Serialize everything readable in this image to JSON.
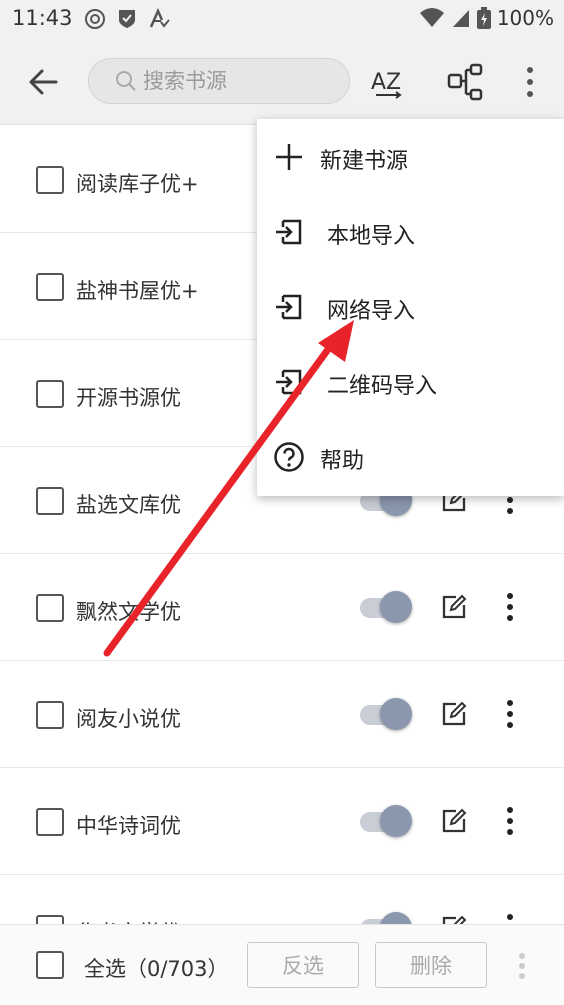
{
  "status_bar": {
    "time": "11:43",
    "battery": "100%",
    "icons": [
      "at-sign-icon",
      "shield-check-icon",
      "translate-icon",
      "wifi-icon",
      "signal-icon",
      "battery-charging-icon"
    ]
  },
  "toolbar": {
    "back_icon": "arrow-left-icon",
    "search_placeholder": "搜索书源",
    "search_icon": "search-icon",
    "sort_icon": "sort-az-icon",
    "group_icon": "group-tree-icon",
    "more_icon": "more-vertical-icon"
  },
  "sources": [
    {
      "name": "阅读库子优+",
      "enabled": true
    },
    {
      "name": "盐神书屋优+",
      "enabled": true
    },
    {
      "name": "开源书源优",
      "enabled": true
    },
    {
      "name": "盐选文库优",
      "enabled": true
    },
    {
      "name": "飘然文学优",
      "enabled": true
    },
    {
      "name": "阅友小说优",
      "enabled": true
    },
    {
      "name": "中华诗词优",
      "enabled": true
    },
    {
      "name": "华书文学优",
      "enabled": true
    }
  ],
  "menu": {
    "items": [
      {
        "label": "新建书源",
        "icon": "plus-icon"
      },
      {
        "label": "本地导入",
        "icon": "import-icon"
      },
      {
        "label": "网络导入",
        "icon": "import-icon"
      },
      {
        "label": "二维码导入",
        "icon": "import-icon"
      },
      {
        "label": "帮助",
        "icon": "help-circle-icon"
      }
    ]
  },
  "bottom_bar": {
    "select_all": "全选（0/703）",
    "invert_label": "反选",
    "delete_label": "删除",
    "more_icon": "more-vertical-icon"
  },
  "colors": {
    "toolbar_bg": "#f1f1f1",
    "toggle_knob": "#8a97ad",
    "toggle_track": "#c9cdd5",
    "annotation_arrow": "#e8232a"
  }
}
